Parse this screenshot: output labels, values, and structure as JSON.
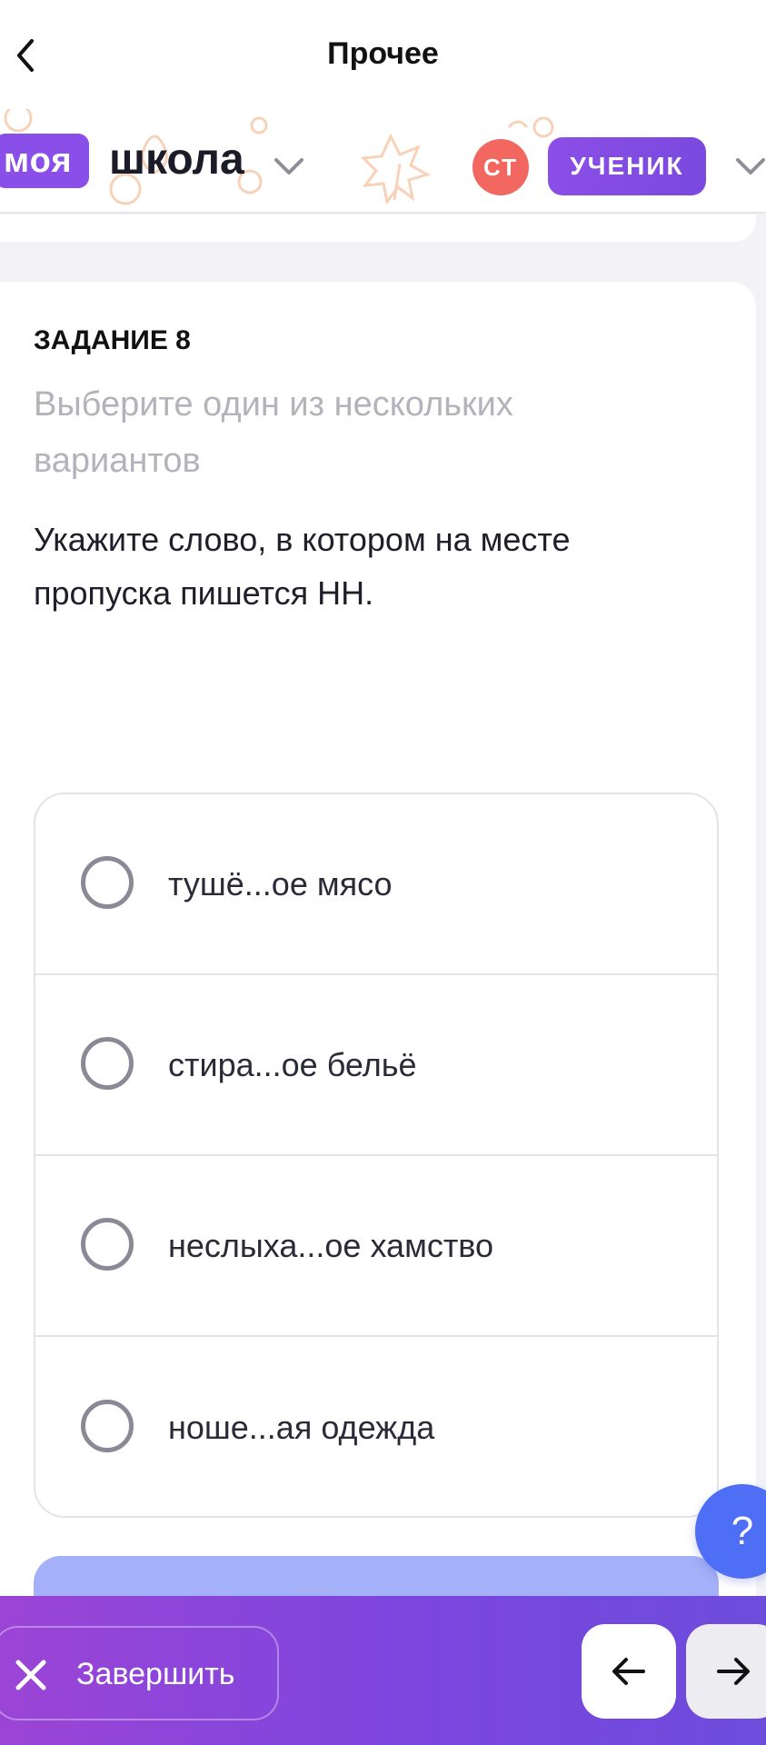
{
  "nav": {
    "title": "Прочее",
    "back_icon": "chevron-left-icon"
  },
  "brand": {
    "logo_badge": "моя",
    "logo_text": "школа",
    "avatar_initials": "СТ",
    "role": "УЧЕНИК",
    "colors": {
      "badge": "#8a4fe8",
      "avatar": "#f26760",
      "role": "#7a49df"
    }
  },
  "task": {
    "label": "ЗАДАНИЕ 8",
    "type": "Выберите один из нескольких вариантов",
    "question": "Укажите слово, в котором на месте пропуска пишется НН.",
    "options": [
      {
        "text": "тушё...ое мясо",
        "selected": false
      },
      {
        "text": "стира...ое бельё",
        "selected": false
      },
      {
        "text": "неслыха...ое хамство",
        "selected": false
      },
      {
        "text": "ноше...ая одежда",
        "selected": false
      }
    ]
  },
  "help": {
    "label": "?"
  },
  "bottom_bar": {
    "finish_label": "Завершить",
    "finish_icon": "close-icon",
    "prev_icon": "arrow-left-icon",
    "next_icon": "arrow-right-icon"
  }
}
